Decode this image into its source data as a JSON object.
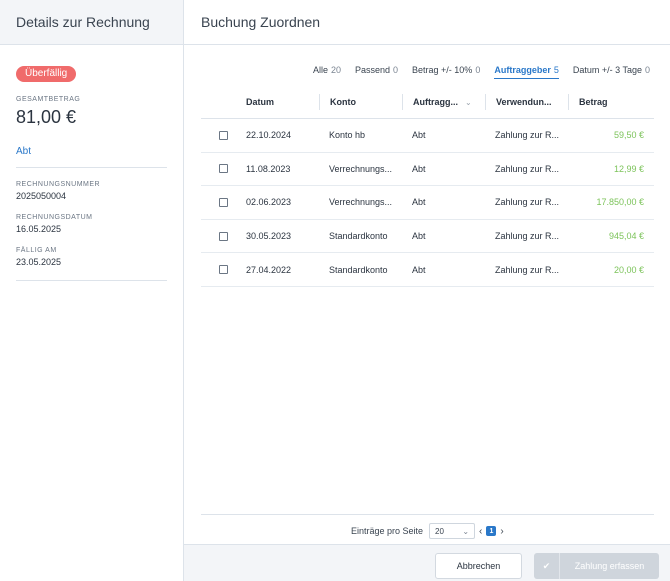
{
  "left": {
    "title": "Details zur Rechnung",
    "badge": "Überfällig",
    "total_label": "GESAMTBETRAG",
    "total_value": "81,00 €",
    "payer_link": "Abt",
    "invoice_number_label": "RECHNUNGSNUMMER",
    "invoice_number": "2025050004",
    "invoice_date_label": "RECHNUNGSDATUM",
    "invoice_date": "16.05.2025",
    "due_label": "FÄLLIG AM",
    "due_date": "23.05.2025"
  },
  "right": {
    "title": "Buchung Zuordnen",
    "filters": [
      {
        "label": "Alle",
        "count": "20"
      },
      {
        "label": "Passend",
        "count": "0"
      },
      {
        "label": "Betrag +/- 10%",
        "count": "0"
      },
      {
        "label": "Auftraggeber",
        "count": "5",
        "active": true
      },
      {
        "label": "Datum +/- 3 Tage",
        "count": "0"
      }
    ],
    "columns": [
      "Datum",
      "Konto",
      "Auftragg...",
      "Verwendun...",
      "Betrag"
    ],
    "rows": [
      {
        "datum": "22.10.2024",
        "konto": "Konto hb",
        "auftraggeber": "Abt",
        "verwendung": "Zahlung zur R...",
        "betrag": "59,50 €"
      },
      {
        "datum": "11.08.2023",
        "konto": "Verrechnungs...",
        "auftraggeber": "Abt",
        "verwendung": "Zahlung zur R...",
        "betrag": "12,99 €"
      },
      {
        "datum": "02.06.2023",
        "konto": "Verrechnungs...",
        "auftraggeber": "Abt",
        "verwendung": "Zahlung zur R...",
        "betrag": "17.850,00 €"
      },
      {
        "datum": "30.05.2023",
        "konto": "Standardkonto",
        "auftraggeber": "Abt",
        "verwendung": "Zahlung zur R...",
        "betrag": "945,04 €"
      },
      {
        "datum": "27.04.2022",
        "konto": "Standardkonto",
        "auftraggeber": "Abt",
        "verwendung": "Zahlung zur R...",
        "betrag": "20,00 €"
      }
    ],
    "pager": {
      "label": "Einträge pro Seite",
      "per_page": "20",
      "page": "1"
    },
    "cancel_label": "Abbrechen",
    "submit_label": "Zahlung erfassen"
  },
  "colors": {
    "accent": "#2a78c9",
    "overdue": "#f06b6b",
    "money": "#7cc35a",
    "disabled": "#cfd5dc"
  }
}
